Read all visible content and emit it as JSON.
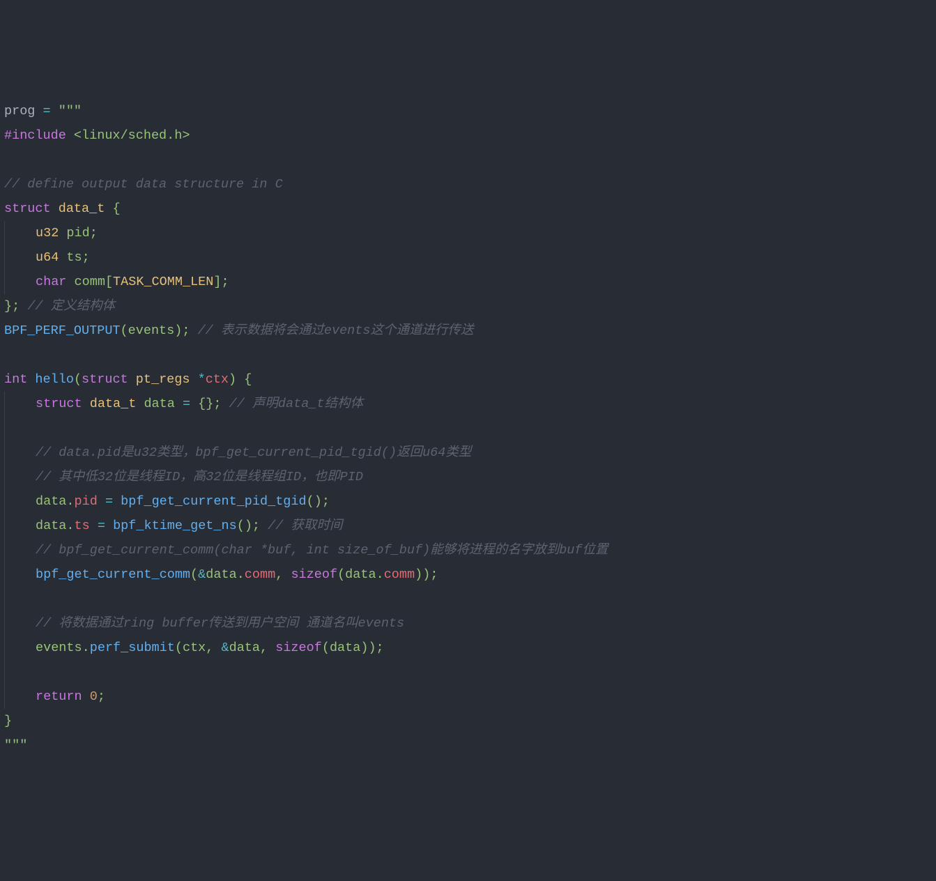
{
  "code": {
    "l1_a": "prog ",
    "l1_b": "=",
    "l1_c": " \"\"\"",
    "l2_a": "#include ",
    "l2_b": "<linux/sched.h>",
    "l3": "",
    "l4": "// define output data structure in C",
    "l5_a": "struct",
    "l5_b": " data_t ",
    "l5_c": "{",
    "l6_a": "u32",
    "l6_b": " pid",
    "l6_c": ";",
    "l7_a": "u64",
    "l7_b": " ts",
    "l7_c": ";",
    "l8_a": "char",
    "l8_b": " comm",
    "l8_c": "[",
    "l8_d": "TASK_COMM_LEN",
    "l8_e": "];",
    "l9_a": "}; ",
    "l9_b": "// 定义结构体",
    "l10_a": "BPF_PERF_OUTPUT",
    "l10_b": "(events); ",
    "l10_c": "// 表示数据将会通过events这个通道进行传送",
    "l11": "",
    "l12_a": "int",
    "l12_b": " ",
    "l12_c": "hello",
    "l12_d": "(",
    "l12_e": "struct",
    "l12_f": " pt_regs ",
    "l12_g": "*",
    "l12_h": "ctx",
    "l12_i": ") {",
    "l13_a": "struct",
    "l13_b": " data_t ",
    "l13_c": "data ",
    "l13_d": "=",
    "l13_e": " {}; ",
    "l13_f": "// 声明data_t结构体",
    "l14": "",
    "l15": "// data.pid是u32类型，bpf_get_current_pid_tgid()返回u64类型",
    "l16": "// 其中低32位是线程ID，高32位是线程组ID，也即PID",
    "l17_a": "data",
    "l17_b": ".",
    "l17_c": "pid",
    "l17_d": " ",
    "l17_e": "=",
    "l17_f": " ",
    "l17_g": "bpf_get_current_pid_tgid",
    "l17_h": "();",
    "l18_a": "data",
    "l18_b": ".",
    "l18_c": "ts",
    "l18_d": " ",
    "l18_e": "=",
    "l18_f": " ",
    "l18_g": "bpf_ktime_get_ns",
    "l18_h": "(); ",
    "l18_i": "// 获取时间",
    "l19": "// bpf_get_current_comm(char *buf, int size_of_buf)能够将进程的名字放到buf位置",
    "l20_a": "bpf_get_current_comm",
    "l20_b": "(",
    "l20_c": "&",
    "l20_d": "data",
    "l20_e": ".",
    "l20_f": "comm",
    "l20_g": ", ",
    "l20_h": "sizeof",
    "l20_i": "(data",
    "l20_j": ".",
    "l20_k": "comm",
    "l20_l": "));",
    "l21": "",
    "l22": "// 将数据通过ring buffer传送到用户空间 通道名叫events",
    "l23_a": "events",
    "l23_b": ".",
    "l23_c": "perf_submit",
    "l23_d": "(ctx, ",
    "l23_e": "&",
    "l23_f": "data, ",
    "l23_g": "sizeof",
    "l23_h": "(data));",
    "l24": "",
    "l25_a": "return",
    "l25_b": " ",
    "l25_c": "0",
    "l25_d": ";",
    "l26": "}",
    "l27": "\"\"\""
  }
}
